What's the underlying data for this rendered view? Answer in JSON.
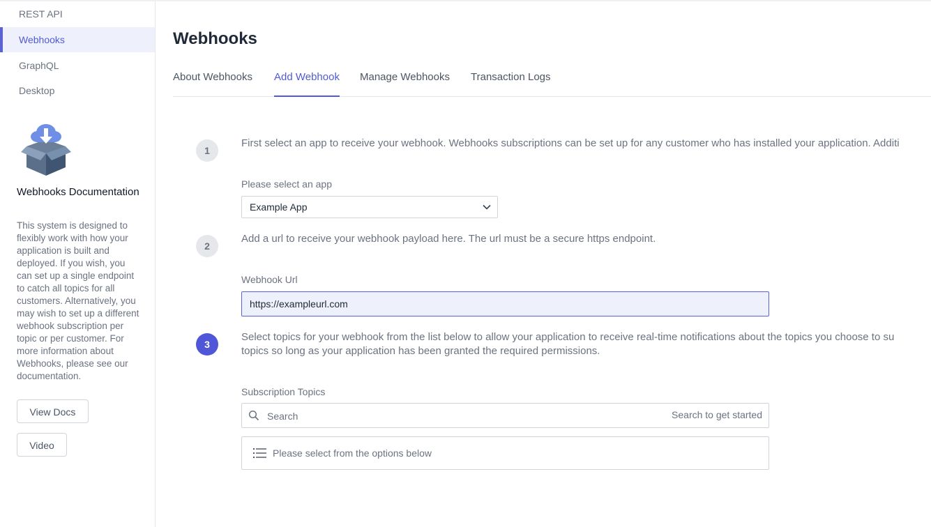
{
  "sidebar": {
    "items": [
      {
        "label": "REST API"
      },
      {
        "label": "Webhooks"
      },
      {
        "label": "GraphQL"
      },
      {
        "label": "Desktop"
      }
    ],
    "doc": {
      "title": "Webhooks Documentation",
      "text": "This system is designed to flexibly work with how your application is built and deployed. If you wish, you can set up a single endpoint to catch all topics for all customers. Alternatively, you may wish to set up a different webhook subscription per topic or per customer. For more information about Webhooks, please see our documentation.",
      "view_docs_label": "View Docs",
      "video_label": "Video"
    }
  },
  "main": {
    "title": "Webhooks",
    "tabs": [
      {
        "label": "About Webhooks"
      },
      {
        "label": "Add Webhook"
      },
      {
        "label": "Manage Webhooks"
      },
      {
        "label": "Transaction Logs"
      }
    ],
    "step1": {
      "number": "1",
      "text": "First select an app to receive your webhook. Webhooks subscriptions can be set up for any customer who has installed your application. Additi",
      "select_label": "Please select an app",
      "select_value": "Example App"
    },
    "step2": {
      "number": "2",
      "text": "Add a url to receive your webhook payload here. The url must be a secure https endpoint.",
      "url_label": "Webhook Url",
      "url_value": "https://exampleurl.com"
    },
    "step3": {
      "number": "3",
      "text_line1": "Select topics for your webhook from the list below to allow your application to receive real-time notifications about the topics you choose to su",
      "text_line2": "topics so long as your application has been granted the required permissions.",
      "topics_label": "Subscription Topics",
      "search_placeholder": "Search",
      "search_hint": "Search to get started",
      "options_text": "Please select from the options below"
    }
  },
  "colors": {
    "accent": "#4f5bd5",
    "active_step": "#4f56d8",
    "sidebar_active_bg": "#eef0fb",
    "input_active_bg": "#eef1fb"
  },
  "icons": [
    "cloud-download-box-icon",
    "chevron-down-icon",
    "search-icon",
    "list-icon"
  ]
}
